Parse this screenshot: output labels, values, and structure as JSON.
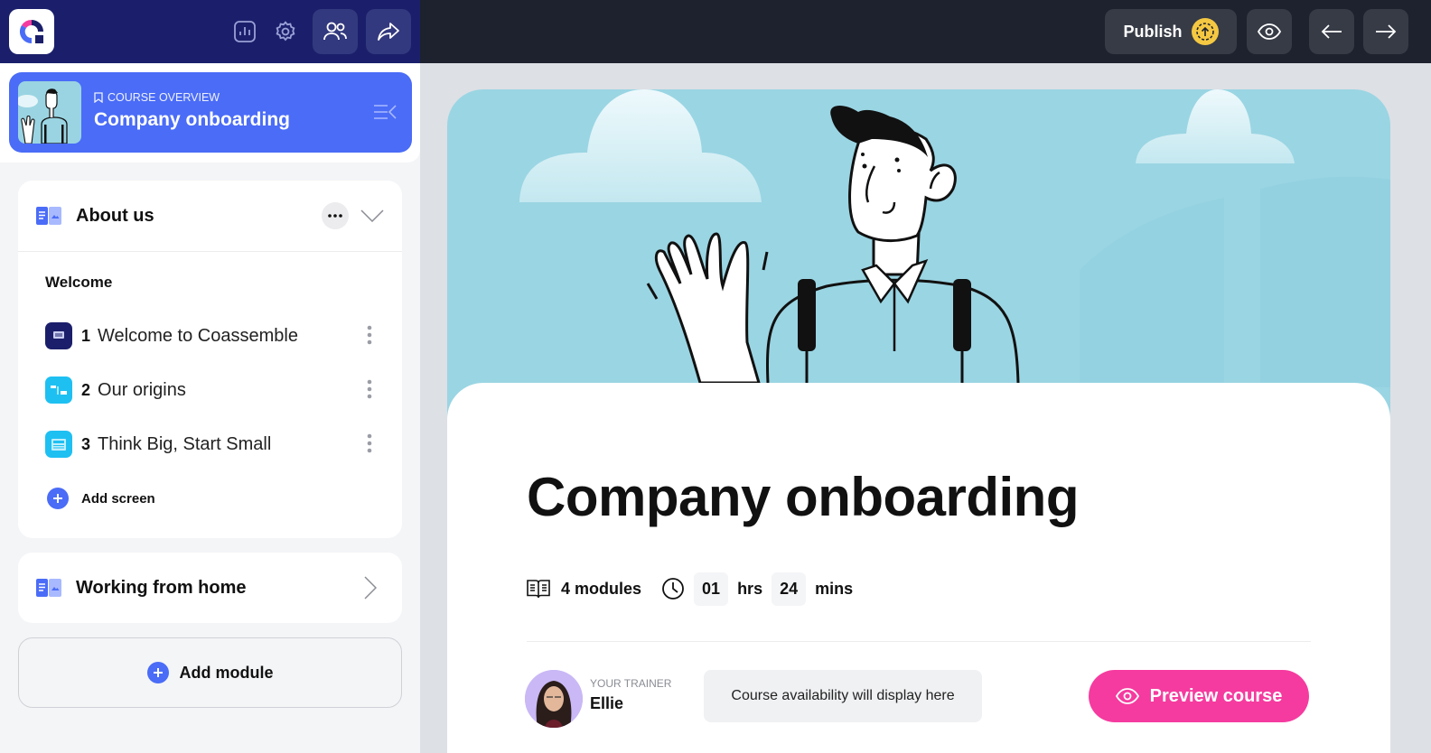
{
  "topbar": {
    "logo_icon": "coassemble-logo",
    "left_icons": [
      "analytics-icon",
      "settings-icon",
      "users-icon",
      "share-icon"
    ],
    "publish_label": "Publish",
    "publish_icon": "upload-circle-icon",
    "right_icons": [
      "eye-icon",
      "arrow-left-icon",
      "arrow-right-icon"
    ],
    "colors": {
      "left_bg": "#1b1f6b",
      "right_bg": "#1d222e",
      "publish_badge": "#f5c842"
    }
  },
  "sidebar": {
    "course_card": {
      "kicker": "COURSE OVERVIEW",
      "title": "Company onboarding",
      "accent": "#4a6cf7"
    },
    "modules": [
      {
        "title": "About us",
        "expanded": true,
        "sections": [
          {
            "label": "Welcome",
            "screens": [
              {
                "num": "1",
                "title": "Welcome to Coassemble",
                "icon": "text-screen-icon",
                "color": "#1b1f6b"
              },
              {
                "num": "2",
                "title": "Our origins",
                "icon": "flow-screen-icon",
                "color": "#1ec0f2"
              },
              {
                "num": "3",
                "title": "Think Big, Start Small",
                "icon": "list-screen-icon",
                "color": "#1ec0f2"
              }
            ]
          }
        ],
        "add_screen_label": "Add screen"
      },
      {
        "title": "Working from home",
        "expanded": false
      }
    ],
    "add_module_label": "Add module"
  },
  "main": {
    "course_title": "Company onboarding",
    "modules_count": "4 modules",
    "duration": {
      "hours": "01",
      "hours_unit": "hrs",
      "minutes": "24",
      "minutes_unit": "mins"
    },
    "trainer": {
      "kicker": "YOUR TRAINER",
      "name": "Ellie"
    },
    "availability_text": "Course availability will display here",
    "preview_label": "Preview course",
    "preview_color": "#f53b9f"
  }
}
